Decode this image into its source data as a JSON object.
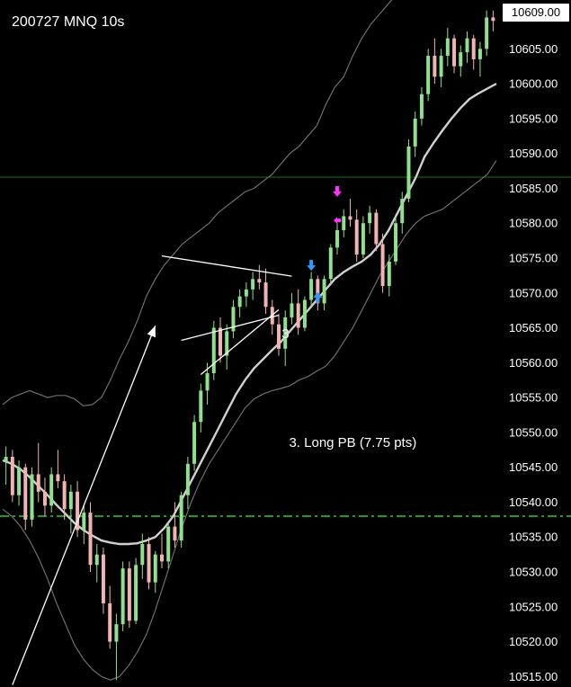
{
  "chart_data": {
    "type": "candlestick",
    "title": "200727 MNQ 10s",
    "ylim": [
      10513.5,
      10612
    ],
    "y_ticks": [
      10515,
      10520,
      10525,
      10530,
      10535,
      10540,
      10545,
      10550,
      10555,
      10560,
      10565,
      10570,
      10575,
      10580,
      10585,
      10590,
      10595,
      10600,
      10605,
      10610
    ],
    "last_price": "10609.00",
    "horizontal_lines": [
      {
        "price": 10538.0,
        "style": "dash-dot",
        "color": "#1e9c1e"
      },
      {
        "price": 10586.6,
        "style": "solid",
        "color": "#1f6b1f"
      }
    ],
    "colors": {
      "up": "#8fe08f",
      "down": "#f2b3b3",
      "ema": "#d0d0d0",
      "band": "#6e6e6e",
      "marker_down": "#ff33ff",
      "marker_up": "#3399ff"
    },
    "candles": [
      [
        10545.8,
        10548.0,
        10542.5,
        10546.5
      ],
      [
        10546.5,
        10547.5,
        10540.0,
        10541.0
      ],
      [
        10541.0,
        10546.0,
        10539.5,
        10545.0
      ],
      [
        10545.0,
        10545.5,
        10536.0,
        10537.5
      ],
      [
        10537.5,
        10545.0,
        10536.5,
        10544.0
      ],
      [
        10544.0,
        10548.5,
        10540.0,
        10541.5
      ],
      [
        10541.5,
        10543.5,
        10538.0,
        10539.5
      ],
      [
        10539.5,
        10545.0,
        10538.5,
        10544.0
      ],
      [
        10544.0,
        10547.5,
        10542.0,
        10543.0
      ],
      [
        10543.0,
        10544.0,
        10537.5,
        10539.0
      ],
      [
        10539.0,
        10542.5,
        10535.5,
        10541.5
      ],
      [
        10541.5,
        10543.0,
        10535.0,
        10536.0
      ],
      [
        10536.0,
        10539.5,
        10534.0,
        10538.5
      ],
      [
        10538.5,
        10540.0,
        10530.0,
        10531.0
      ],
      [
        10531.0,
        10534.0,
        10528.5,
        10532.5
      ],
      [
        10532.5,
        10533.5,
        10524.0,
        10525.5
      ],
      [
        10525.5,
        10528.0,
        10519.0,
        10520.0
      ],
      [
        10520.0,
        10524.0,
        10514.5,
        10522.5
      ],
      [
        10522.5,
        10531.5,
        10521.5,
        10530.5
      ],
      [
        10530.5,
        10531.5,
        10522.0,
        10523.0
      ],
      [
        10523.0,
        10532.0,
        10522.5,
        10531.0
      ],
      [
        10531.0,
        10535.5,
        10529.0,
        10534.0
      ],
      [
        10534.0,
        10535.0,
        10527.5,
        10528.5
      ],
      [
        10528.5,
        10533.0,
        10527.0,
        10532.5
      ],
      [
        10532.5,
        10535.5,
        10530.5,
        10531.5
      ],
      [
        10531.5,
        10537.0,
        10530.5,
        10536.5
      ],
      [
        10536.5,
        10540.0,
        10533.5,
        10534.5
      ],
      [
        10534.5,
        10541.5,
        10533.5,
        10541.0
      ],
      [
        10541.0,
        10546.5,
        10539.0,
        10545.5
      ],
      [
        10545.5,
        10552.5,
        10544.5,
        10551.5
      ],
      [
        10551.5,
        10557.0,
        10550.0,
        10556.0
      ],
      [
        10556.0,
        10560.0,
        10554.0,
        10558.5
      ],
      [
        10558.5,
        10566.0,
        10557.5,
        10565.0
      ],
      [
        10565.0,
        10566.5,
        10560.0,
        10561.0
      ],
      [
        10561.0,
        10565.5,
        10559.0,
        10564.5
      ],
      [
        10564.5,
        10569.0,
        10563.5,
        10568.0
      ],
      [
        10568.0,
        10570.5,
        10566.5,
        10569.5
      ],
      [
        10569.5,
        10571.5,
        10568.0,
        10570.5
      ],
      [
        10570.5,
        10573.0,
        10569.0,
        10572.0
      ],
      [
        10572.0,
        10574.0,
        10570.5,
        10571.5
      ],
      [
        10571.5,
        10573.5,
        10567.0,
        10568.0
      ],
      [
        10568.0,
        10569.0,
        10564.0,
        10565.5
      ],
      [
        10565.5,
        10567.0,
        10561.0,
        10562.0
      ],
      [
        10562.0,
        10567.5,
        10559.5,
        10566.5
      ],
      [
        10566.5,
        10570.0,
        10565.5,
        10568.5
      ],
      [
        10568.5,
        10570.5,
        10564.0,
        10565.0
      ],
      [
        10565.0,
        10569.5,
        10564.5,
        10569.0
      ],
      [
        10569.0,
        10573.0,
        10568.0,
        10572.0
      ],
      [
        10572.0,
        10572.5,
        10567.5,
        10568.5
      ],
      [
        10568.5,
        10572.5,
        10567.5,
        10572.0
      ],
      [
        10572.0,
        10577.0,
        10571.5,
        10576.5
      ],
      [
        10576.5,
        10580.0,
        10575.5,
        10579.0
      ],
      [
        10579.0,
        10582.0,
        10578.0,
        10581.0
      ],
      [
        10581.0,
        10583.5,
        10579.5,
        10580.5
      ],
      [
        10580.5,
        10582.0,
        10574.5,
        10575.5
      ],
      [
        10575.5,
        10581.0,
        10575.0,
        10580.0
      ],
      [
        10580.0,
        10582.5,
        10578.5,
        10581.5
      ],
      [
        10581.5,
        10582.0,
        10576.0,
        10577.0
      ],
      [
        10577.0,
        10578.5,
        10570.0,
        10571.0
      ],
      [
        10571.0,
        10575.5,
        10569.5,
        10574.5
      ],
      [
        10574.5,
        10581.0,
        10574.0,
        10580.0
      ],
      [
        10580.0,
        10584.5,
        10578.5,
        10583.5
      ],
      [
        10583.5,
        10592.0,
        10583.0,
        10591.0
      ],
      [
        10591.0,
        10596.0,
        10589.5,
        10595.0
      ],
      [
        10595.0,
        10599.5,
        10594.0,
        10598.5
      ],
      [
        10598.5,
        10605.0,
        10597.5,
        10604.0
      ],
      [
        10604.0,
        10606.5,
        10600.0,
        10601.0
      ],
      [
        10601.0,
        10605.0,
        10599.5,
        10604.0
      ],
      [
        10604.0,
        10608.0,
        10602.5,
        10606.5
      ],
      [
        10606.5,
        10607.0,
        10601.5,
        10602.5
      ],
      [
        10602.5,
        10605.5,
        10601.0,
        10604.5
      ],
      [
        10604.5,
        10607.5,
        10603.0,
        10606.5
      ],
      [
        10606.5,
        10607.0,
        10602.0,
        10603.5
      ],
      [
        10603.5,
        10606.0,
        10601.0,
        10605.0
      ],
      [
        10605.0,
        10610.5,
        10604.0,
        10609.5
      ],
      [
        10609.5,
        10610.5,
        10607.5,
        10609.0
      ]
    ],
    "ema": [
      10546.0,
      10545.5,
      10544.7,
      10543.6,
      10542.3,
      10541.0,
      10539.6,
      10538.3,
      10537.0,
      10536.0,
      10535.2,
      10534.5,
      10534.2,
      10534.0,
      10534.0,
      10534.1,
      10534.5,
      10535.0,
      10536.3,
      10538.0,
      10540.5,
      10543.0,
      10545.5,
      10548.0,
      10550.5,
      10553.0,
      10555.5,
      10557.5,
      10559.2,
      10560.5,
      10561.8,
      10563.0,
      10564.5,
      10566.0,
      10567.5,
      10569.0,
      10570.5,
      10572.0,
      10573.0,
      10573.8,
      10574.5,
      10575.5,
      10577.0,
      10579.0,
      10581.5,
      10584.0,
      10586.5,
      10589.5,
      10591.5,
      10593.3,
      10595.0,
      10596.5,
      10597.8,
      10598.6,
      10599.3,
      10600.0
    ],
    "bb_upper": [
      10554.0,
      10555.0,
      10555.5,
      10556.0,
      10555.5,
      10555.0,
      10555.3,
      10555.3,
      10554.8,
      10553.8,
      10554.0,
      10555.0,
      10557.5,
      10560.5,
      10563.0,
      10566.0,
      10569.5,
      10572.0,
      10574.0,
      10575.5,
      10577.0,
      10578.0,
      10579.0,
      10580.0,
      10581.5,
      10582.5,
      10583.5,
      10584.5,
      10585.0,
      10586.0,
      10587.0,
      10588.5,
      10590.0,
      10591.0,
      10592.5,
      10594.0,
      10597.0,
      10599.5,
      10601.0,
      10604.0,
      10606.5,
      10608.5,
      10610.0,
      10611.5,
      10613.0,
      10614.0,
      10616.0,
      10617.5,
      10619.0,
      10621.0,
      10622.5,
      10624.0,
      10625.0,
      10626.0,
      10627.5,
      10628.5
    ],
    "bb_lower": [
      10539.0,
      10538.0,
      10536.5,
      10534.5,
      10532.0,
      10529.0,
      10525.5,
      10522.5,
      10519.5,
      10517.5,
      10516.0,
      10515.0,
      10514.5,
      10515.0,
      10516.5,
      10518.5,
      10521.0,
      10524.5,
      10528.5,
      10532.5,
      10536.5,
      10540.0,
      10543.0,
      10545.5,
      10547.5,
      10549.5,
      10551.5,
      10553.5,
      10554.8,
      10555.5,
      10556.0,
      10556.3,
      10556.7,
      10557.5,
      10558.0,
      10558.8,
      10559.5,
      10561.0,
      10563.0,
      10565.0,
      10567.5,
      10570.0,
      10572.5,
      10574.5,
      10576.5,
      10578.5,
      10580.0,
      10581.0,
      10581.5,
      10582.0,
      10583.0,
      10584.0,
      10585.0,
      10586.0,
      10587.0,
      10589.0
    ],
    "markers": [
      {
        "type": "down-arrow",
        "bar": 51,
        "price": 10584.3,
        "color": "#ff33ff"
      },
      {
        "type": "left-arrow",
        "bar": 51,
        "price": 10580.4,
        "color": "#ff33ff"
      },
      {
        "type": "down-arrow",
        "bar": 47,
        "price": 10573.7,
        "color": "#3399ff"
      },
      {
        "type": "up-arrow",
        "bar": 48,
        "price": 10569.6,
        "color": "#3399ff"
      }
    ],
    "trendlines": [
      {
        "from": [
          1,
          10513.8
        ],
        "to": [
          23,
          10565.3
        ],
        "color": "#ffffff",
        "arrow": true
      },
      {
        "from": [
          24,
          10575.3
        ],
        "to": [
          44,
          10572.4
        ],
        "color": "#ffffff",
        "arrow": false
      },
      {
        "from": [
          27,
          10563.2
        ],
        "to": [
          42,
          10566.8
        ],
        "color": "#ffffff",
        "arrow": false
      },
      {
        "from": [
          30,
          10558.3
        ],
        "to": [
          42,
          10567.6
        ],
        "color": "#ffffff",
        "arrow": false
      }
    ],
    "annotations": [
      {
        "text": "3",
        "bar": 43,
        "price": 10564.0
      },
      {
        "text": "3. Long PB (7.75 pts)",
        "bar": 44,
        "price": 10548.5
      }
    ]
  }
}
